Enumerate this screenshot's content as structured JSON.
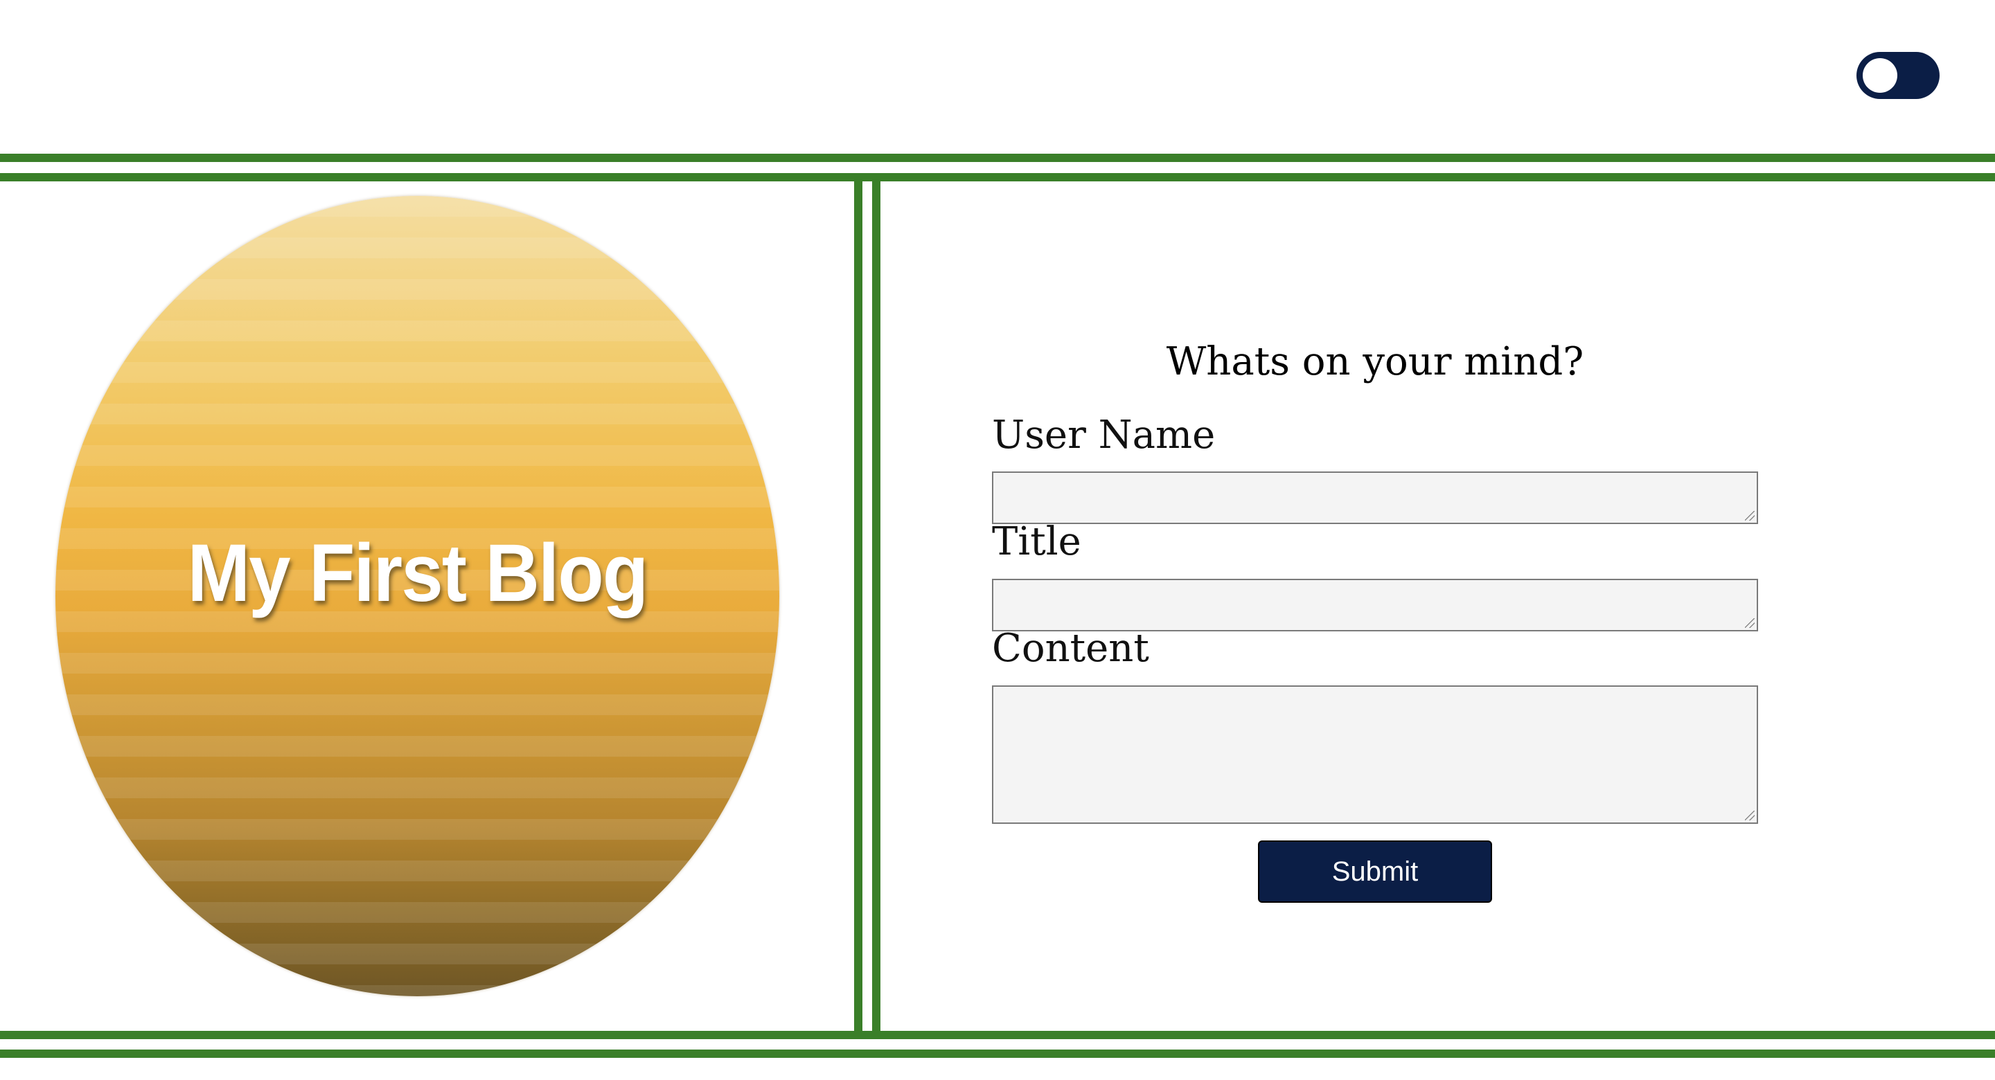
{
  "header": {
    "theme_toggle": {
      "state": "off"
    }
  },
  "logo": {
    "text": "My First Blog"
  },
  "form": {
    "heading": "Whats on your mind?",
    "username_label": "User Name",
    "username_value": "",
    "title_label": "Title",
    "title_value": "",
    "content_label": "Content",
    "content_value": "",
    "submit_label": "Submit"
  },
  "colors": {
    "accent_green": "#3a7f29",
    "navy": "#0b1e46",
    "field_background": "#f4f4f4"
  }
}
